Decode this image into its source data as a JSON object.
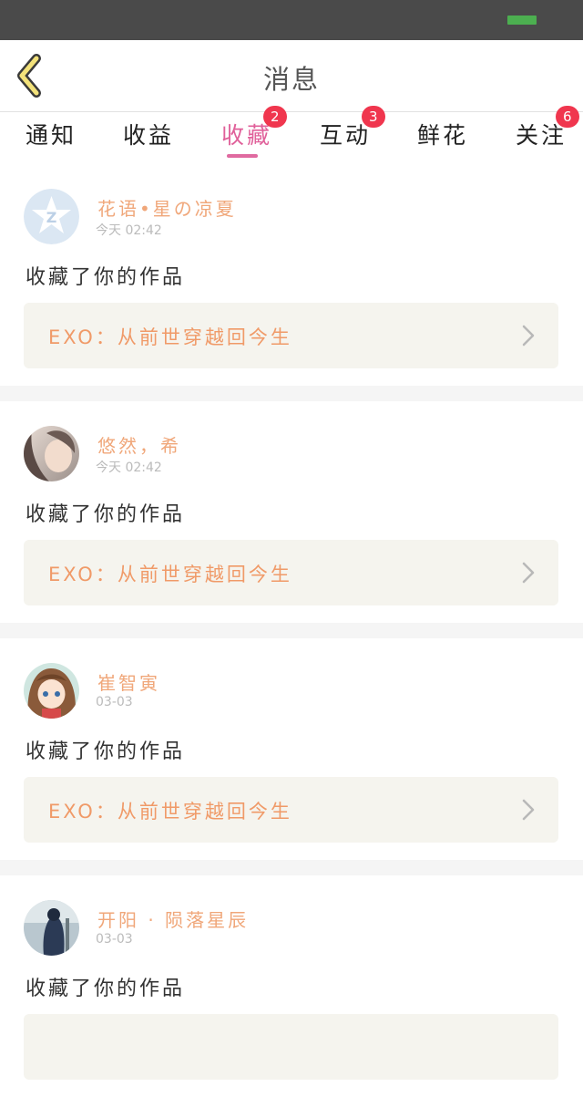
{
  "header": {
    "title": "消息"
  },
  "tabs": [
    {
      "label": "通知",
      "badge": ""
    },
    {
      "label": "收益",
      "badge": ""
    },
    {
      "label": "收藏",
      "badge": "2"
    },
    {
      "label": "互动",
      "badge": "3"
    },
    {
      "label": "鲜花",
      "badge": ""
    },
    {
      "label": "关注",
      "badge": "6"
    }
  ],
  "active_tab": "收藏",
  "colors": {
    "accent": "#e0609a",
    "badge": "#f0364e",
    "username": "#f0a77a",
    "work_title": "#f09a68"
  },
  "items": [
    {
      "username": "花语•星の凉夏",
      "time": "今天  02:42",
      "action": "收藏了你的作品",
      "work": "EXO：从前世穿越回今生",
      "avatar": "qq-default-star-avatar"
    },
    {
      "username": "悠然，希",
      "time": "今天  02:42",
      "action": "收藏了你的作品",
      "work": "EXO：从前世穿越回今生",
      "avatar": "girl-photo-avatar"
    },
    {
      "username": "崔智寅",
      "time": "03-03",
      "action": "收藏了你的作品",
      "work": "EXO：从前世穿越回今生",
      "avatar": "anime-girl-avatar"
    },
    {
      "username": "开阳 · 陨落星辰",
      "time": "03-03",
      "action": "收藏了你的作品",
      "work": "",
      "avatar": "photo-avatar"
    }
  ]
}
